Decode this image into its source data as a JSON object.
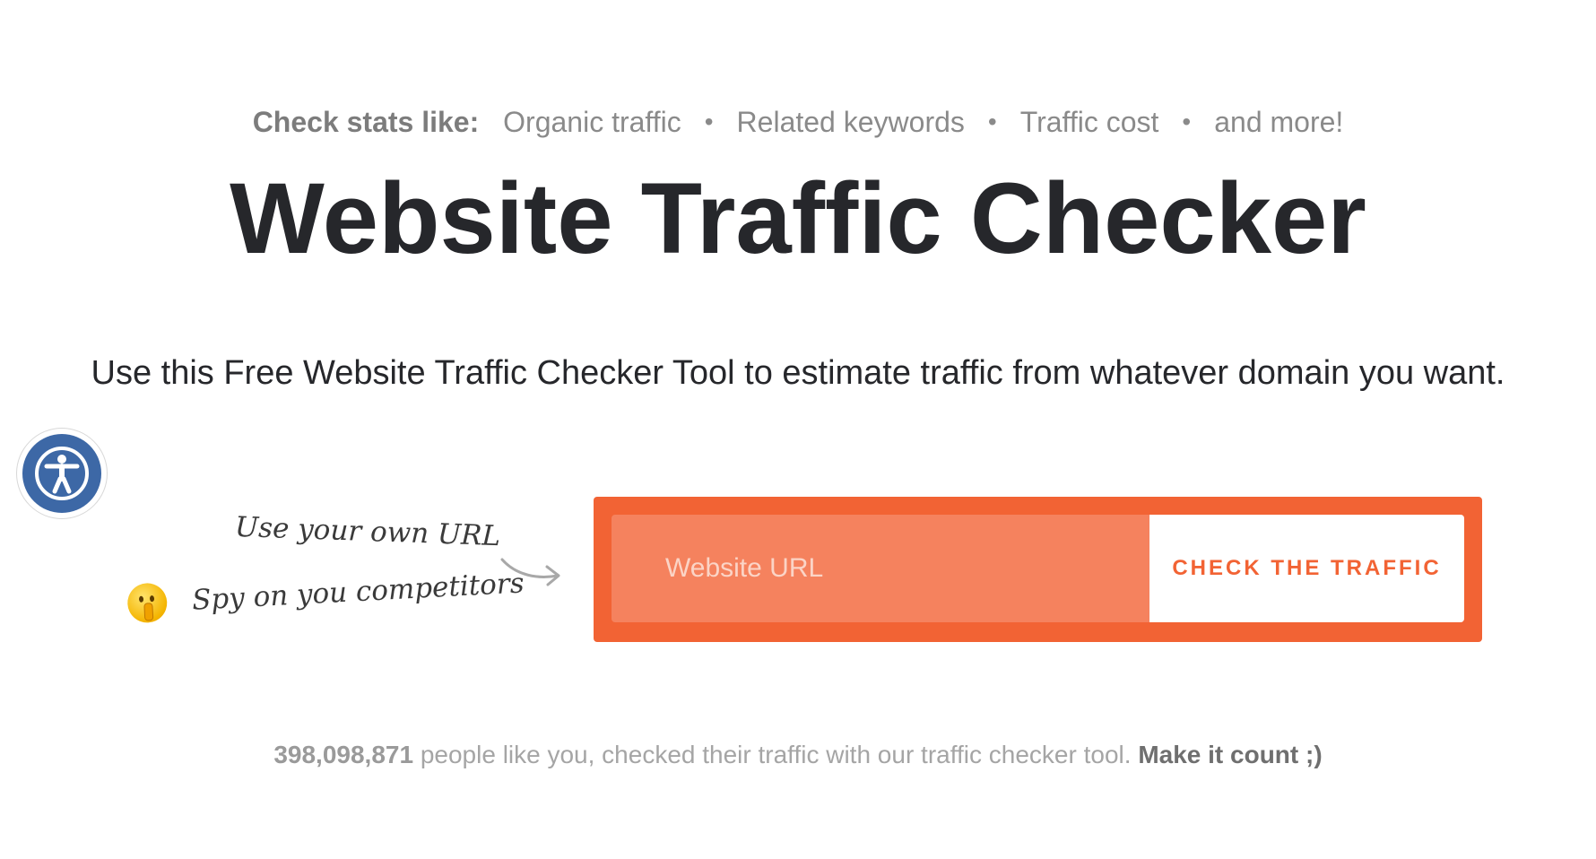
{
  "stats": {
    "label": "Check stats like:",
    "items": [
      "Organic traffic",
      "Related keywords",
      "Traffic cost",
      "and more!"
    ],
    "separator": "•"
  },
  "title": "Website Traffic Checker",
  "subtitle": "Use this Free Website Traffic Checker Tool to estimate traffic from whatever domain you want.",
  "hints": {
    "own_url": "Use your own URL",
    "spy": "Spy on you competitors"
  },
  "search": {
    "placeholder": "Website URL",
    "value": "",
    "button_label": "CHECK THE TRAFFIC"
  },
  "counter": {
    "count": "398,098,871",
    "text": " people like you, checked their traffic with our traffic checker tool. ",
    "cta": "Make it count ;)"
  },
  "colors": {
    "accent": "#f26334",
    "input_bg": "#f5825e",
    "title": "#26272b",
    "accessibility": "#3d68a6"
  },
  "icons": {
    "accessibility": "accessibility-icon",
    "emoji": "shushing-face-icon",
    "arrow": "curved-arrow-icon"
  }
}
